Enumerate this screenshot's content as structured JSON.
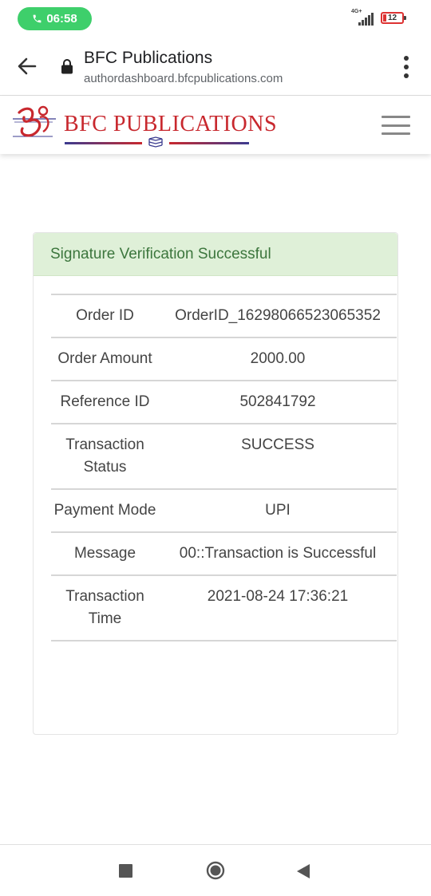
{
  "status_bar": {
    "time": "06:58",
    "network": "4G+",
    "battery": "12",
    "icons": [
      "phone-icon",
      "signal-icon",
      "battery-icon"
    ]
  },
  "browser": {
    "title": "BFC Publications",
    "url": "authordashboard.bfcpublications.com",
    "icons": [
      "back-arrow-icon",
      "lock-icon",
      "more-vert-icon"
    ]
  },
  "site_header": {
    "brand": "BFC PUBLICATIONS",
    "icons": [
      "logo-icon",
      "books-icon",
      "hamburger-menu-icon"
    ]
  },
  "alert": {
    "message": "Signature Verification Successful"
  },
  "details": [
    {
      "label": "Order ID",
      "value": "OrderID_16298066523065352"
    },
    {
      "label": "Order Amount",
      "value": "2000.00"
    },
    {
      "label": "Reference ID",
      "value": "502841792"
    },
    {
      "label": "Transaction Status",
      "value": "SUCCESS"
    },
    {
      "label": "Payment Mode",
      "value": "UPI"
    },
    {
      "label": "Message",
      "value": "00::Transaction is Successful"
    },
    {
      "label": "Transaction Time",
      "value": "2021-08-24 17:36:21"
    }
  ],
  "nav_bar": {
    "icons": [
      "recents-icon",
      "home-icon",
      "back-icon"
    ]
  },
  "colors": {
    "call_pill": "#3ecf6b",
    "brand_red": "#c8282e",
    "alert_bg": "#dff0d8",
    "alert_text": "#3c763d"
  }
}
